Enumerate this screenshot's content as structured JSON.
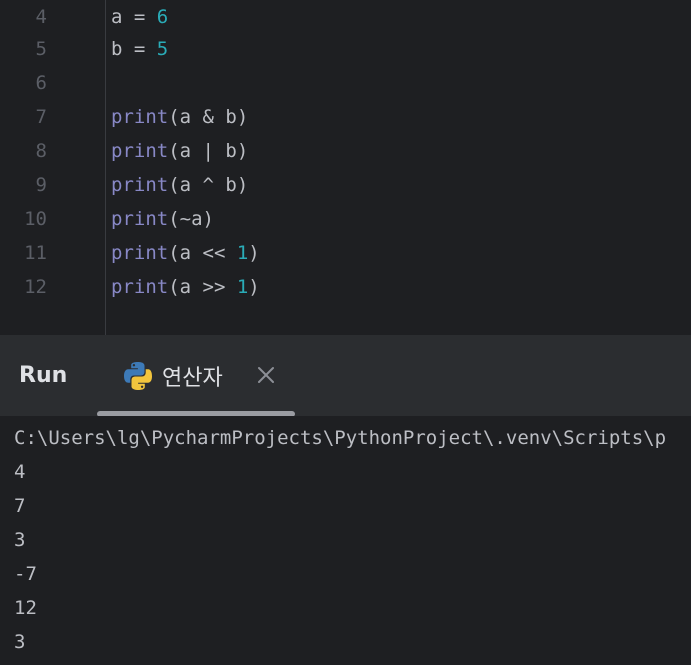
{
  "editor": {
    "lines": [
      {
        "num": "4",
        "parts": [
          {
            "t": "a = ",
            "c": "plain"
          },
          {
            "t": "6",
            "c": "num"
          }
        ]
      },
      {
        "num": "5",
        "parts": [
          {
            "t": "b = ",
            "c": "plain"
          },
          {
            "t": "5",
            "c": "num"
          }
        ]
      },
      {
        "num": "6",
        "parts": []
      },
      {
        "num": "7",
        "parts": [
          {
            "t": "print",
            "c": "kw"
          },
          {
            "t": "(a & b)",
            "c": "plain"
          }
        ]
      },
      {
        "num": "8",
        "parts": [
          {
            "t": "print",
            "c": "kw"
          },
          {
            "t": "(a | b)",
            "c": "plain"
          }
        ]
      },
      {
        "num": "9",
        "parts": [
          {
            "t": "print",
            "c": "kw"
          },
          {
            "t": "(a ^ b)",
            "c": "plain"
          }
        ]
      },
      {
        "num": "10",
        "parts": [
          {
            "t": "print",
            "c": "kw"
          },
          {
            "t": "(~a)",
            "c": "plain"
          }
        ]
      },
      {
        "num": "11",
        "parts": [
          {
            "t": "print",
            "c": "kw"
          },
          {
            "t": "(a << ",
            "c": "plain"
          },
          {
            "t": "1",
            "c": "num"
          },
          {
            "t": ")",
            "c": "plain"
          }
        ]
      },
      {
        "num": "12",
        "parts": [
          {
            "t": "print",
            "c": "kw"
          },
          {
            "t": "(a >> ",
            "c": "plain"
          },
          {
            "t": "1",
            "c": "num"
          },
          {
            "t": ")",
            "c": "plain"
          }
        ]
      }
    ]
  },
  "run_panel": {
    "title": "Run",
    "tab_label": "연산자",
    "tab_icon": "python-icon",
    "close_icon": "close-icon"
  },
  "console": {
    "lines": [
      "C:\\Users\\lg\\PycharmProjects\\PythonProject\\.venv\\Scripts\\p",
      "4",
      "7",
      "3",
      "-7",
      "12",
      "3"
    ]
  },
  "colors": {
    "editor_bg": "#1e1f22",
    "panel_bg": "#2b2d30",
    "keyword": "#8888c6",
    "number": "#2aacb8",
    "text": "#bcbec4"
  }
}
